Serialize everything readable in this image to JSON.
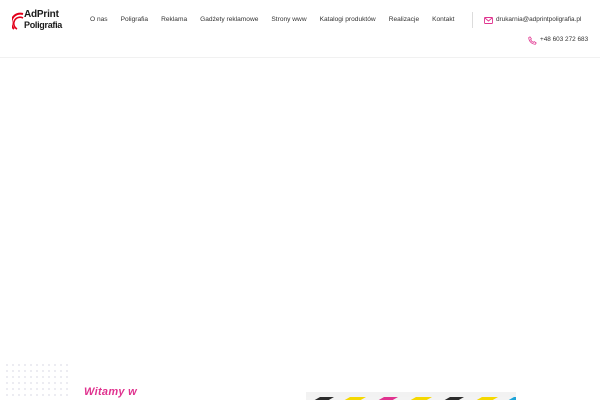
{
  "brand": {
    "line1": "AdPrint",
    "line2": "Poligrafia",
    "accent": "#e2001a"
  },
  "nav": {
    "items": [
      {
        "label": "O nas"
      },
      {
        "label": "Poligrafia"
      },
      {
        "label": "Reklama"
      },
      {
        "label": "Gadżety reklamowe"
      },
      {
        "label": "Strony www"
      },
      {
        "label": "Katalogi produktów"
      },
      {
        "label": "Realizacje"
      },
      {
        "label": "Kontakt"
      }
    ]
  },
  "contact": {
    "email": "drukarnia@adprintpoligrafia.pl",
    "phone": "+48 603 272 683",
    "icon_color": "#e0338f"
  },
  "hero": {
    "welcome": "Witamy w",
    "accent": "#e0338f"
  }
}
